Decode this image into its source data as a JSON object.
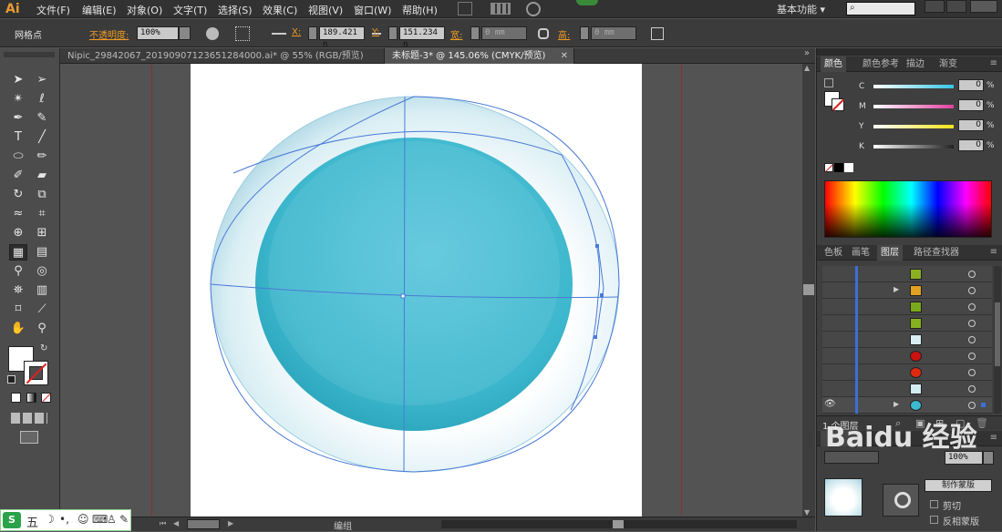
{
  "app": {
    "logo": "Ai",
    "workspace": "基本功能 ▾"
  },
  "menu": [
    "文件(F)",
    "编辑(E)",
    "对象(O)",
    "文字(T)",
    "选择(S)",
    "效果(C)",
    "视图(V)",
    "窗口(W)",
    "帮助(H)"
  ],
  "control_bar": {
    "selection_label": "网格点",
    "opacity_label": "不透明度:",
    "opacity_value": "100%",
    "x_label": "X:",
    "x_value": "189.421 n",
    "y_label": "Y:",
    "y_value": "151.234 n",
    "w_label": "宽:",
    "w_value": "0 mm",
    "h_label": "高:",
    "h_value": "0 mm"
  },
  "tabs": [
    {
      "label": "Nipic_29842067_20190907123651284000.ai* @ 55% (RGB/预览)",
      "active": false
    },
    {
      "label": "未标题-3* @ 145.06% (CMYK/预览)",
      "active": true
    }
  ],
  "color_panel": {
    "tabs": [
      "颜色",
      "颜色参考",
      "描边",
      "渐变"
    ],
    "sliders": [
      {
        "label": "C",
        "value": "0",
        "unit": "%",
        "color": "#37c6e6"
      },
      {
        "label": "M",
        "value": "0",
        "unit": "%",
        "color": "#e040a0"
      },
      {
        "label": "Y",
        "value": "0",
        "unit": "%",
        "color": "#f2e21a"
      },
      {
        "label": "K",
        "value": "0",
        "unit": "%",
        "color": "#222222"
      }
    ]
  },
  "layers_panel": {
    "tabs": [
      "色板",
      "画笔",
      "图层",
      "路径查找器"
    ],
    "thumb_colors": [
      "#8ab020",
      "#e0a020",
      "#7aa81c",
      "#86b21e",
      "#d8eef2",
      "#cc1111",
      "#dd2a10",
      "#d2ecf2",
      "#3bbad0"
    ],
    "status": "1 个图层"
  },
  "transparency_panel": {
    "opacity_value": "100%",
    "clip_label": "剪切",
    "invert_mask_label": "反相蒙版",
    "make_mask_label": "制作蒙版"
  },
  "status_bar": {
    "label": "编组"
  },
  "ime": {
    "label": "五"
  },
  "watermark": "Baidu 经验",
  "colors": {
    "cyan_disk": "#3bb9cf",
    "bubble_edge": "#b6dce8",
    "path": "#4a7ad8"
  }
}
